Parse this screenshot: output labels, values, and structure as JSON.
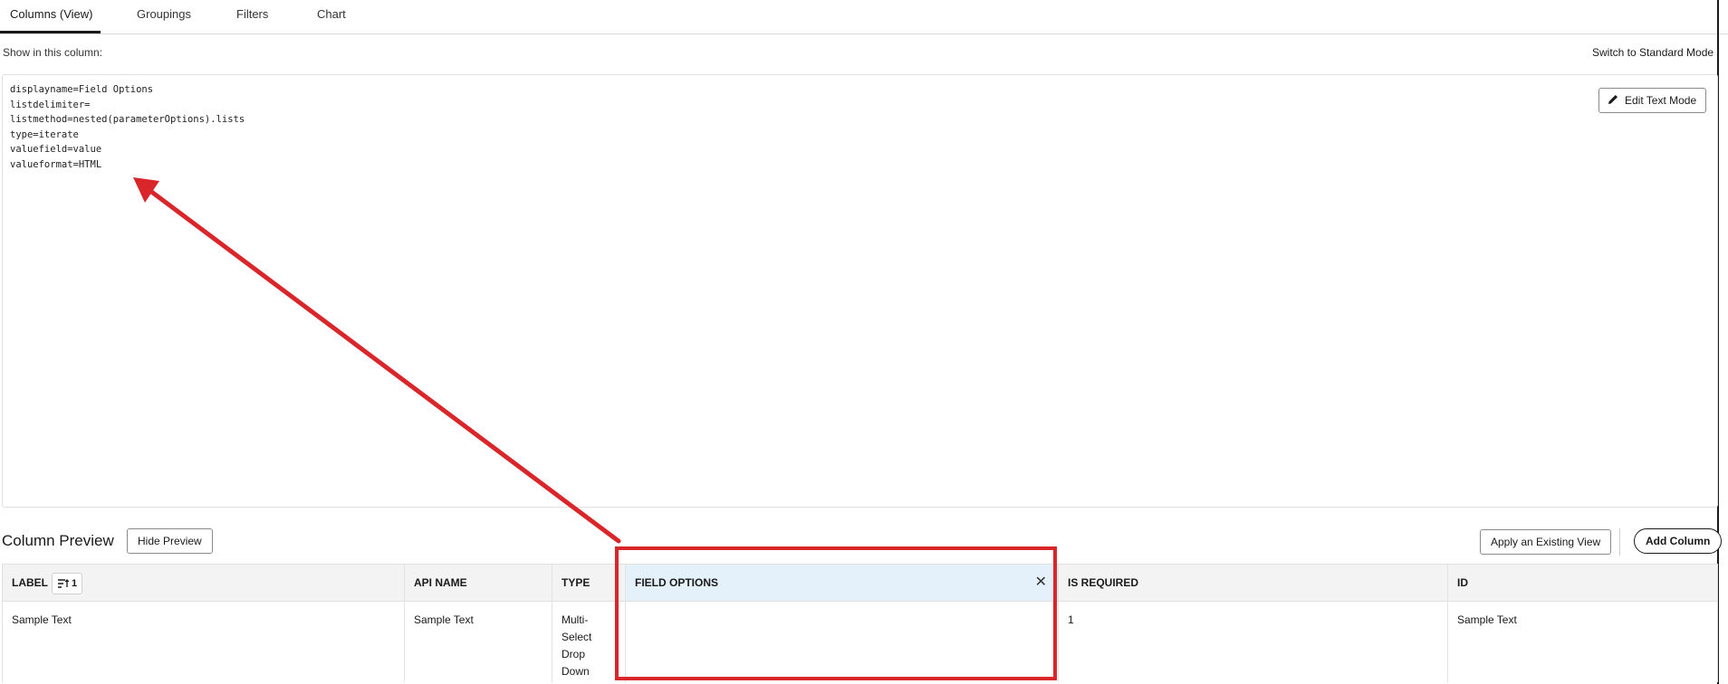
{
  "tabs": [
    {
      "label": "Columns (View)",
      "active": true
    },
    {
      "label": "Groupings",
      "active": false
    },
    {
      "label": "Filters",
      "active": false
    },
    {
      "label": "Chart",
      "active": false
    }
  ],
  "show_label": "Show in this column:",
  "switch_mode": "Switch to Standard Mode",
  "editor": {
    "lines": [
      "displayname=Field Options",
      "listdelimiter=",
      "listmethod=nested(parameterOptions).lists",
      "type=iterate",
      "valuefield=value",
      "valueformat=HTML"
    ],
    "edit_button": "Edit Text Mode"
  },
  "preview": {
    "title": "Column Preview",
    "hide_button": "Hide Preview",
    "apply_button": "Apply an Existing View",
    "add_button": "Add Column"
  },
  "table": {
    "sort_badge": "1",
    "columns": [
      "LABEL",
      "API NAME",
      "TYPE",
      "FIELD OPTIONS",
      "IS REQUIRED",
      "ID"
    ],
    "row": {
      "label": "Sample Text",
      "api_name": "Sample Text",
      "type_lines": [
        "Multi-",
        "Select",
        "Drop",
        "Down"
      ],
      "field_options": "",
      "is_required": "1",
      "id": "Sample Text"
    }
  },
  "colors": {
    "annotation": "#d9262b",
    "active_header": "#e4f1fb",
    "header_bg": "#f3f3f3"
  },
  "icons": [
    "pencil-icon",
    "sort-icon",
    "close-icon",
    "annotation-arrow"
  ]
}
